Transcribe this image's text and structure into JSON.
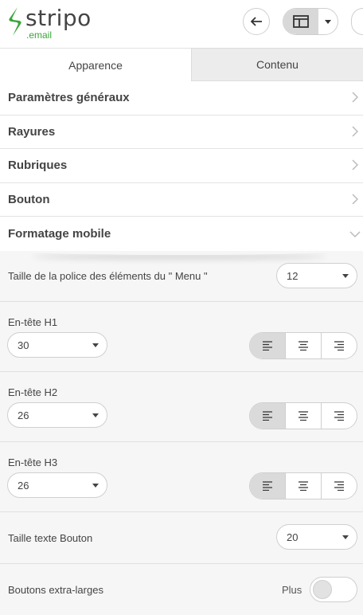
{
  "logo": {
    "name": "stripo",
    "sub": ".email"
  },
  "tabs": [
    {
      "label": "Apparence"
    },
    {
      "label": "Contenu"
    }
  ],
  "accordion": [
    {
      "label": "Paramètres généraux"
    },
    {
      "label": "Rayures"
    },
    {
      "label": "Rubriques"
    },
    {
      "label": "Bouton"
    },
    {
      "label": "Formatage mobile"
    }
  ],
  "settings": {
    "menu_font": {
      "label": "Taille de la police des éléments du \" Menu \"",
      "value": "12"
    },
    "h1": {
      "label": "En-tête H1",
      "value": "30"
    },
    "h2": {
      "label": "En-tête H2",
      "value": "26"
    },
    "h3": {
      "label": "En-tête H3",
      "value": "26"
    },
    "button_text": {
      "label": "Taille texte Bouton",
      "value": "20"
    },
    "wide_buttons": {
      "label": "Boutons extra-larges",
      "toggle_label": "Plus",
      "enabled": false
    }
  },
  "colors": {
    "accent_green": "#3aa63a",
    "active_segment": "#dadada"
  }
}
